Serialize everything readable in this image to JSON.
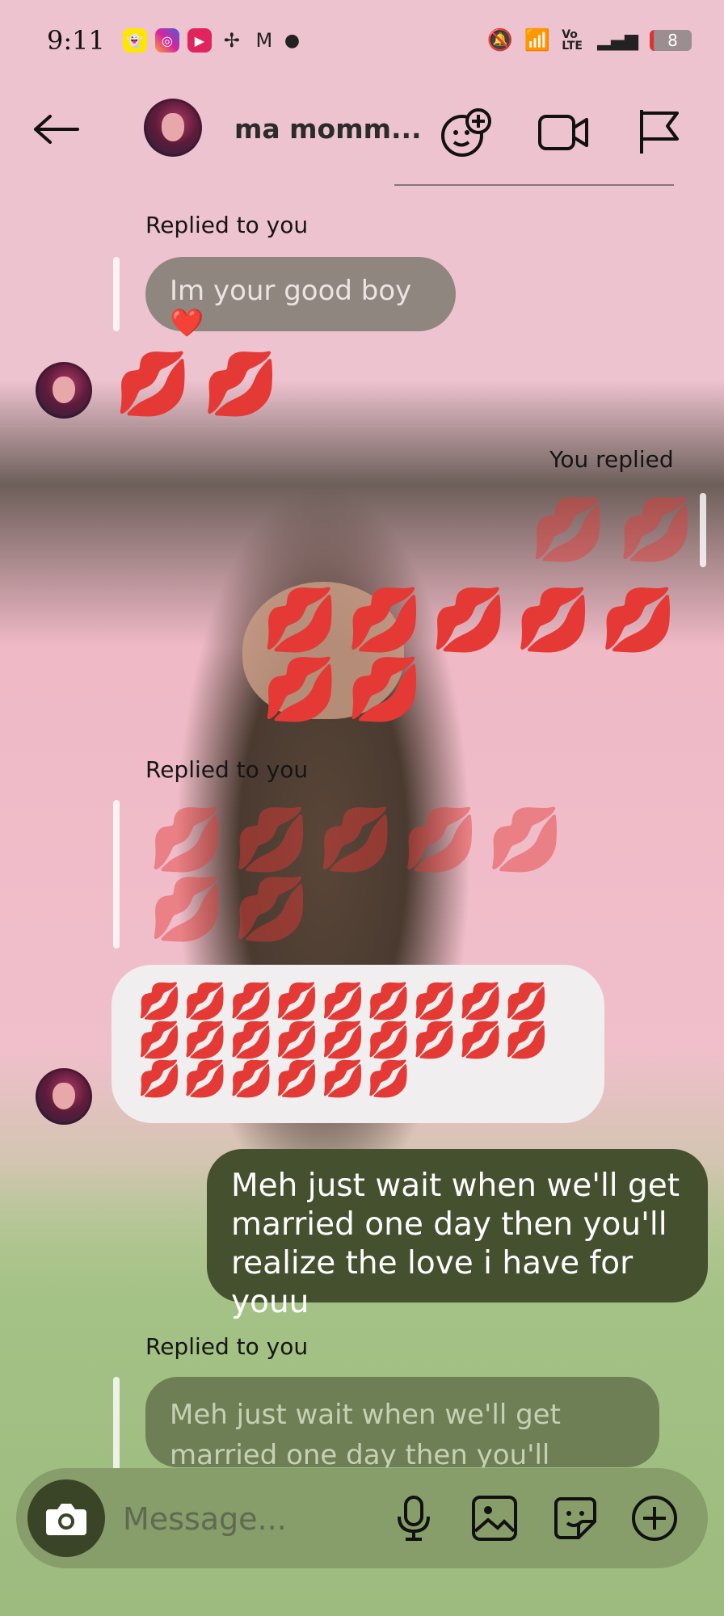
{
  "status_bar": {
    "time": "9:11",
    "battery": "8",
    "network": "Vo LTE"
  },
  "header": {
    "contact_name": "ma momm...",
    "icons": [
      "back-arrow-icon",
      "add-friend-icon",
      "video-call-icon",
      "flag-icon"
    ]
  },
  "messages": {
    "reply1_label": "Replied to you",
    "reply1_quote": "Im your good boy❤️",
    "received1": "💋💋",
    "reply2_label": "You replied",
    "reply2_quote": "💋💋",
    "sent1": "💋💋💋💋💋💋💋",
    "reply3_label": "Replied to you",
    "reply3_quote": "💋💋💋💋💋💋💋",
    "received2": "💋💋💋💋💋💋💋💋💋💋💋💋💋💋💋💋💋💋💋💋💋💋💋💋",
    "sent2": "Meh just wait when we'll get married one day then you'll realize the love i have for youu",
    "reply4_label": "Replied to you",
    "reply4_quote": "Meh just wait when we'll get married one day then you'll realize"
  },
  "composer": {
    "placeholder": "Message..."
  },
  "colors": {
    "lips": "#e23630",
    "sent_bubble": "#45502f",
    "composer": "#879d6a"
  }
}
